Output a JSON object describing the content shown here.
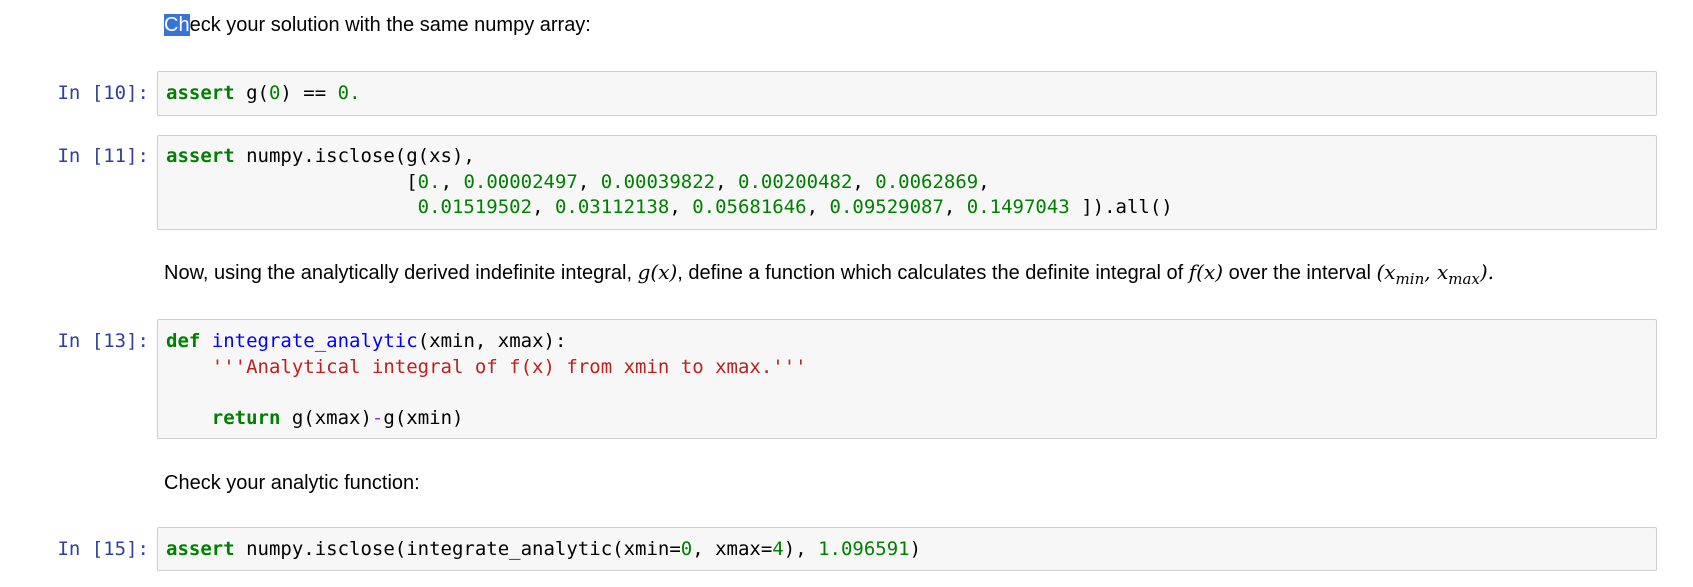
{
  "cells": [
    {
      "type": "markdown",
      "highlight": "Ch",
      "text": "eck your solution with the same numpy array:"
    },
    {
      "type": "code",
      "prompt": "In [10]:",
      "code": "assert g(0) == 0."
    },
    {
      "type": "code",
      "prompt": "In [11]:",
      "code": "assert numpy.isclose(g(xs),\n                     [0., 0.00002497, 0.00039822, 0.00200482, 0.0062869,\n                      0.01519502, 0.03112138, 0.05681646, 0.09529087, 0.1497043 ]).all()"
    },
    {
      "type": "markdown",
      "text_before": "Now, using the analytically derived indefinite integral, ",
      "g": "g(x)",
      "text_mid": ", define a function which calculates the definite integral of ",
      "f": "f(x)",
      "text_after": " over the interval ",
      "interval_open": "(",
      "xmin_base": "x",
      "xmin_sub": "min",
      "comma": ", ",
      "xmax_base": "x",
      "xmax_sub": "max",
      "interval_close": ").",
      "period": ""
    },
    {
      "type": "code",
      "prompt": "In [13]:",
      "code": "def integrate_analytic(xmin, xmax):\n    '''Analytical integral of f(x) from xmin to xmax.'''\n\n    return g(xmax)-g(xmin)"
    },
    {
      "type": "markdown",
      "text": "Check your analytic function:"
    },
    {
      "type": "code",
      "prompt": "In [15]:",
      "code": "assert numpy.isclose(integrate_analytic(xmin=0, xmax=4), 1.096591)"
    }
  ],
  "tokens": {
    "c10": [
      "assert",
      " g(",
      "0",
      ") == ",
      "0."
    ],
    "c11_l1": [
      "assert",
      " numpy.isclose(g(xs),"
    ],
    "c11_l2": [
      "                     [",
      "0.",
      ", ",
      "0.00002497",
      ", ",
      "0.00039822",
      ", ",
      "0.00200482",
      ", ",
      "0.0062869",
      ","
    ],
    "c11_l3": [
      "                      ",
      "0.01519502",
      ", ",
      "0.03112138",
      ", ",
      "0.05681646",
      ", ",
      "0.09529087",
      ", ",
      "0.1497043",
      " ]).all()"
    ],
    "c13_l1": [
      "def",
      " ",
      "integrate_analytic",
      "(xmin, xmax):"
    ],
    "c13_l2": [
      "    ",
      "'''Analytical integral of f(x) from xmin to xmax.'''"
    ],
    "c13_l4": [
      "    ",
      "return",
      " g(xmax)",
      "-",
      "g(xmin)"
    ],
    "c15": [
      "assert",
      " numpy.isclose(integrate_analytic(xmin=",
      "0",
      ", xmax=",
      "4",
      "), ",
      "1.096591",
      ")"
    ]
  }
}
